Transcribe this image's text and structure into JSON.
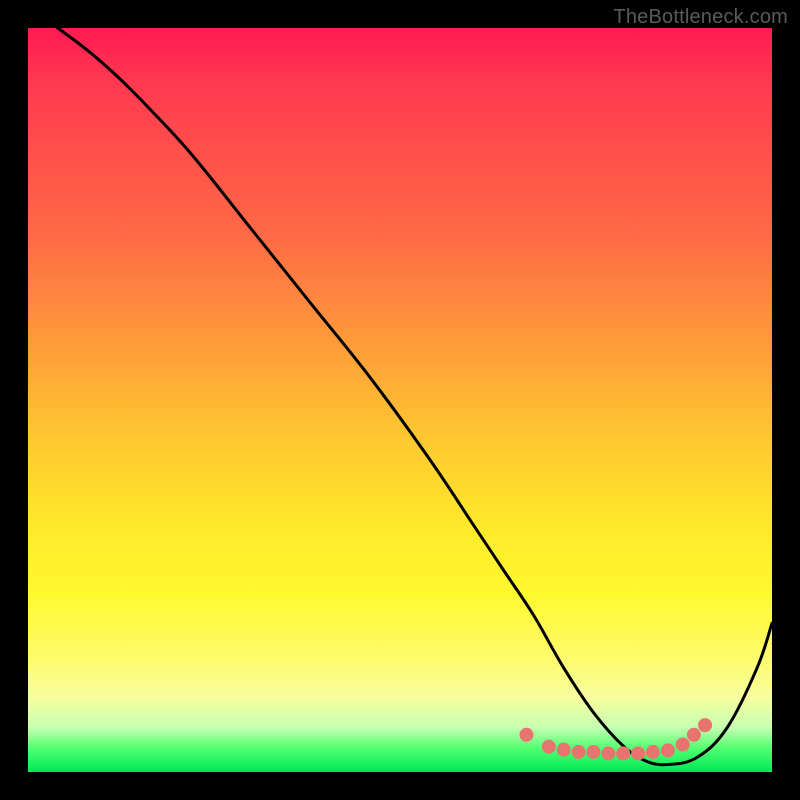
{
  "watermark": "TheBottleneck.com",
  "colors": {
    "frame_bg": "#000000",
    "curve_stroke": "#000000",
    "marker_fill": "#e9736e",
    "marker_stroke": "#e9736e"
  },
  "chart_data": {
    "type": "line",
    "title": "",
    "xlabel": "",
    "ylabel": "",
    "xlim": [
      0,
      100
    ],
    "ylim": [
      0,
      100
    ],
    "grid": false,
    "legend": false,
    "series": [
      {
        "name": "curve",
        "x": [
          4,
          8,
          12,
          16,
          22,
          30,
          38,
          46,
          54,
          60,
          64,
          68,
          72,
          76,
          80,
          83,
          86,
          90,
          94,
          98,
          100
        ],
        "values": [
          100,
          97,
          93.5,
          89.5,
          83,
          73,
          63,
          53,
          42,
          33,
          27,
          21,
          14,
          8,
          3.5,
          1.5,
          1,
          2,
          6,
          14,
          20
        ]
      }
    ],
    "markers": [
      {
        "x": 67,
        "y": 5.0
      },
      {
        "x": 70,
        "y": 3.4
      },
      {
        "x": 72,
        "y": 3.0
      },
      {
        "x": 74,
        "y": 2.7
      },
      {
        "x": 76,
        "y": 2.7
      },
      {
        "x": 78,
        "y": 2.5
      },
      {
        "x": 80,
        "y": 2.5
      },
      {
        "x": 82,
        "y": 2.5
      },
      {
        "x": 84,
        "y": 2.7
      },
      {
        "x": 86,
        "y": 2.9
      },
      {
        "x": 88,
        "y": 3.7
      },
      {
        "x": 89.5,
        "y": 5.0
      },
      {
        "x": 91,
        "y": 6.3
      }
    ]
  }
}
